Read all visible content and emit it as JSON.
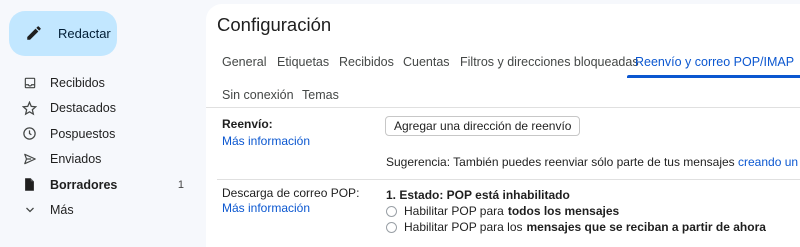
{
  "sidebar": {
    "compose_label": "Redactar",
    "items": [
      {
        "label": "Recibidos",
        "icon": "inbox-icon",
        "count": ""
      },
      {
        "label": "Destacados",
        "icon": "star-icon",
        "count": ""
      },
      {
        "label": "Pospuestos",
        "icon": "clock-icon",
        "count": ""
      },
      {
        "label": "Enviados",
        "icon": "send-icon",
        "count": ""
      },
      {
        "label": "Borradores",
        "icon": "draft-icon",
        "count": "1"
      },
      {
        "label": "Más",
        "icon": "chevron-down-icon",
        "count": ""
      }
    ]
  },
  "main": {
    "title": "Configuración",
    "tabs": [
      {
        "label": "General"
      },
      {
        "label": "Etiquetas"
      },
      {
        "label": "Recibidos"
      },
      {
        "label": "Cuentas"
      },
      {
        "label": "Filtros y direcciones bloqueadas"
      },
      {
        "label": "Reenvío y correo POP/IMAP",
        "active": true
      },
      {
        "label": "Sin conexión"
      },
      {
        "label": "Temas"
      }
    ],
    "forwarding": {
      "label": "Reenvío:",
      "more_info": "Más información",
      "add_button": "Agregar una dirección de reenvío",
      "tip_prefix": "Sugerencia: También puedes reenviar sólo parte de tus mensajes",
      "tip_link": "creando un filtro"
    },
    "pop": {
      "label": "Descarga de correo POP:",
      "more_info": "Más información",
      "status": "1. Estado: POP está inhabilitado",
      "option1_prefix": "Habilitar POP para",
      "option1_bold": "todos los mensajes",
      "option2_prefix": "Habilitar POP para los",
      "option2_bold": "mensajes que se reciban a partir de ahora"
    }
  },
  "colors": {
    "accent": "#0b57d0",
    "compose_bg": "#c2e7ff",
    "page_bg": "#f6f8fc"
  }
}
